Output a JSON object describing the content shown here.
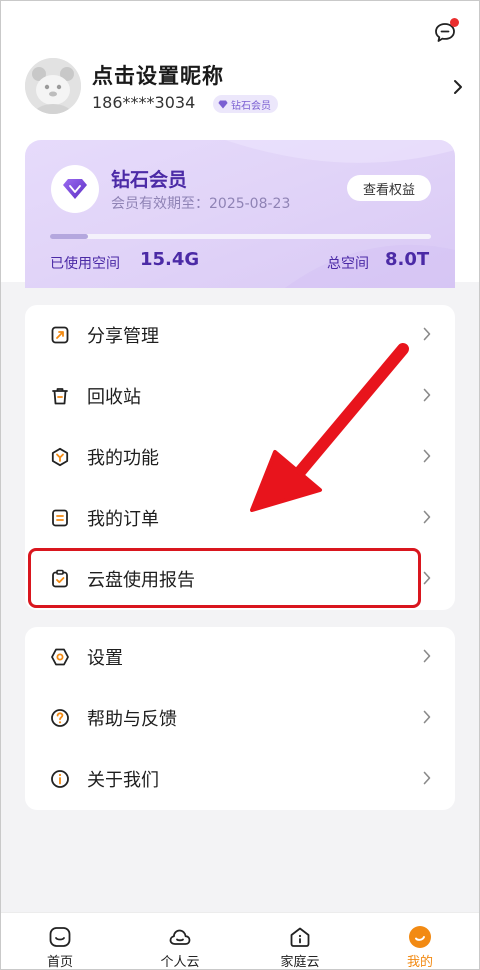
{
  "header": {
    "nickname": "点击设置昵称",
    "phone": "186****3034",
    "member_badge": "钻石会员",
    "message_icon": "chat-bubble-icon"
  },
  "vip_card": {
    "title": "钻石会员",
    "expiry": "会员有效期至：2025-08-23",
    "view_rights_button": "查看权益",
    "used_label": "已使用空间",
    "used_value": "15.4G",
    "total_label": "总空间",
    "total_value": "8.0T",
    "usage_fraction": 0.02,
    "accent_color": "#4b2aa6"
  },
  "menu_group_1": [
    {
      "label": "分享管理",
      "icon": "share-manage-icon"
    },
    {
      "label": "回收站",
      "icon": "trash-icon"
    },
    {
      "label": "我的功能",
      "icon": "features-icon"
    },
    {
      "label": "我的订单",
      "icon": "order-icon"
    },
    {
      "label": "云盘使用报告",
      "icon": "report-clipboard-icon"
    }
  ],
  "menu_group_2": [
    {
      "label": "设置",
      "icon": "settings-icon"
    },
    {
      "label": "帮助与反馈",
      "icon": "help-icon"
    },
    {
      "label": "关于我们",
      "icon": "info-icon"
    }
  ],
  "tabbar": {
    "tabs": [
      {
        "label": "首页",
        "icon": "home-icon",
        "active": false
      },
      {
        "label": "个人云",
        "icon": "cloud-icon",
        "active": false
      },
      {
        "label": "家庭云",
        "icon": "family-cloud-icon",
        "active": false
      },
      {
        "label": "我的",
        "icon": "profile-icon",
        "active": true
      }
    ],
    "active_color": "#f28a13"
  }
}
